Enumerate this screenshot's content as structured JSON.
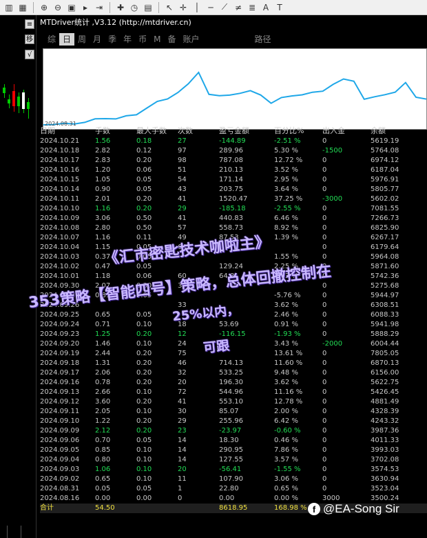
{
  "toolbar": {
    "icons": [
      "chart-bars-icon",
      "chart-candles-icon",
      "zoom-in-icon",
      "zoom-out-icon",
      "tile-windows-icon",
      "auto-scroll-icon",
      "chart-shift-icon",
      "new-order-icon",
      "periodicity-icon",
      "template-icon",
      "cursor-icon",
      "crosshair-icon",
      "vertical-line-icon",
      "horizontal-line-icon",
      "trendline-icon",
      "channel-icon",
      "fibonacci-icon",
      "text-icon",
      "label-icon"
    ]
  },
  "panel": {
    "title": "MTDriver统计 ,V3.12 (http://mtdriver.cn)",
    "menu": [
      "综",
      "日",
      "周",
      "月",
      "季",
      "年",
      "币",
      "M",
      "备",
      "账户",
      "路径"
    ],
    "active_menu": "日",
    "side_buttons": [
      "≡",
      "移",
      "√"
    ],
    "equity_start_label": "2024.08.31"
  },
  "table": {
    "headers": [
      "日期",
      "手数",
      "最大手数",
      "次数",
      "盈亏金额",
      "百分比%",
      "出入金",
      "余额"
    ],
    "rows": [
      [
        "2024.10.21",
        "1.56",
        "0.18",
        "27",
        "-144.89",
        "-2.51 %",
        "0",
        "5619.19"
      ],
      [
        "2024.10.18",
        "2.82",
        "0.12",
        "97",
        "289.96",
        "5.30 %",
        "-1500",
        "5764.08"
      ],
      [
        "2024.10.17",
        "2.83",
        "0.20",
        "98",
        "787.08",
        "12.72 %",
        "0",
        "6974.12"
      ],
      [
        "2024.10.16",
        "1.20",
        "0.06",
        "51",
        "210.13",
        "3.52 %",
        "0",
        "6187.04"
      ],
      [
        "2024.10.15",
        "1.05",
        "0.05",
        "54",
        "171.14",
        "2.95 %",
        "0",
        "5976.91"
      ],
      [
        "2024.10.14",
        "0.90",
        "0.05",
        "43",
        "203.75",
        "3.64 %",
        "0",
        "5805.77"
      ],
      [
        "2024.10.11",
        "2.01",
        "0.20",
        "41",
        "1520.47",
        "37.25 %",
        "-3000",
        "5602.02"
      ],
      [
        "2024.10.10",
        "1.16",
        "0.20",
        "29",
        "-185.18",
        "-2.55 %",
        "0",
        "7081.55"
      ],
      [
        "2024.10.09",
        "3.06",
        "0.50",
        "41",
        "440.83",
        "6.46 %",
        "0",
        "7266.73"
      ],
      [
        "2024.10.08",
        "2.80",
        "0.50",
        "57",
        "558.73",
        "8.92 %",
        "0",
        "6825.90"
      ],
      [
        "2024.10.07",
        "1.16",
        "0.11",
        "49",
        "87.53",
        "1.39 %",
        "0",
        "6267.17"
      ],
      [
        "2024.10.04",
        "1.15",
        "0.05",
        "64",
        "",
        "",
        "0",
        "6179.64"
      ],
      [
        "2024.10.03",
        "0.37",
        "0.05",
        "",
        "",
        "1.55 %",
        "0",
        "5964.08"
      ],
      [
        "2024.10.02",
        "0.47",
        "0.05",
        "",
        "129.24",
        "2.25 %",
        "0",
        "5871.60"
      ],
      [
        "2024.10.01",
        "1.18",
        "0.06",
        "60",
        "64.81",
        "1.03 %",
        "0",
        "5742.36"
      ],
      [
        "2024.09.30",
        "2.07",
        "0.30",
        "39",
        "",
        "",
        "0",
        "5275.68"
      ],
      [
        "2024.09.27",
        "0.81",
        "0.05",
        "",
        "",
        "-5.76 %",
        "0",
        "5944.97"
      ],
      [
        "2024.09.26",
        "",
        "",
        "33",
        "",
        "3.62 %",
        "0",
        "6308.51"
      ],
      [
        "2024.09.25",
        "0.65",
        "0.05",
        "",
        "",
        "2.46 %",
        "0",
        "6088.33"
      ],
      [
        "2024.09.24",
        "0.71",
        "0.10",
        "18",
        "53.69",
        "0.91 %",
        "0",
        "5941.98"
      ],
      [
        "2024.09.23",
        "1.25",
        "0.20",
        "12",
        "-116.15",
        "-1.93 %",
        "0",
        "5888.29"
      ],
      [
        "2024.09.20",
        "1.46",
        "0.10",
        "24",
        "",
        "3.43 %",
        "-2000",
        "6004.44"
      ],
      [
        "2024.09.19",
        "2.44",
        "0.20",
        "75",
        "",
        "13.61 %",
        "0",
        "7805.05"
      ],
      [
        "2024.09.18",
        "1.31",
        "0.20",
        "46",
        "714.13",
        "11.60 %",
        "0",
        "6870.13"
      ],
      [
        "2024.09.17",
        "2.06",
        "0.20",
        "32",
        "533.25",
        "9.48 %",
        "0",
        "6156.00"
      ],
      [
        "2024.09.16",
        "0.78",
        "0.20",
        "20",
        "196.30",
        "3.62 %",
        "0",
        "5622.75"
      ],
      [
        "2024.09.13",
        "2.66",
        "0.10",
        "72",
        "544.96",
        "11.16 %",
        "0",
        "5426.45"
      ],
      [
        "2024.09.12",
        "3.60",
        "0.20",
        "41",
        "553.10",
        "12.78 %",
        "0",
        "4881.49"
      ],
      [
        "2024.09.11",
        "2.05",
        "0.10",
        "30",
        "85.07",
        "2.00 %",
        "0",
        "4328.39"
      ],
      [
        "2024.09.10",
        "1.22",
        "0.20",
        "29",
        "255.96",
        "6.42 %",
        "0",
        "4243.32"
      ],
      [
        "2024.09.09",
        "2.12",
        "0.20",
        "23",
        "-23.97",
        "-0.60 %",
        "0",
        "3987.36"
      ],
      [
        "2024.09.06",
        "0.70",
        "0.05",
        "14",
        "18.30",
        "0.46 %",
        "0",
        "4011.33"
      ],
      [
        "2024.09.05",
        "0.85",
        "0.10",
        "14",
        "290.95",
        "7.86 %",
        "0",
        "3993.03"
      ],
      [
        "2024.09.04",
        "0.80",
        "0.10",
        "14",
        "127.55",
        "3.57 %",
        "0",
        "3702.08"
      ],
      [
        "2024.09.03",
        "1.06",
        "0.10",
        "20",
        "-56.41",
        "-1.55 %",
        "0",
        "3574.53"
      ],
      [
        "2024.09.02",
        "0.65",
        "0.10",
        "11",
        "107.90",
        "3.06 %",
        "0",
        "3630.94"
      ],
      [
        "2024.08.31",
        "0.05",
        "0.05",
        "1",
        "22.80",
        "0.65 %",
        "0",
        "3523.04"
      ],
      [
        "2024.08.16",
        "0.00",
        "0.00",
        "0",
        "0.00",
        "0.00 %",
        "3000",
        "3500.24"
      ]
    ],
    "total": [
      "合计",
      "54.50",
      "",
      "",
      "8618.95",
      "168.98 %",
      "",
      ""
    ]
  },
  "watermark": {
    "line1": "《汇市密匙技术咖啦主》",
    "line2": "353策略【智能四号】策略，总体回撤控制在",
    "line3": "25%以内，",
    "line4": "可跟"
  },
  "credit": {
    "text": "@EA-Song Sir",
    "icon": "facebook-icon"
  },
  "colors": {
    "positive": "#f0f0f0",
    "negative": "#22dd55",
    "total": "#f0e040",
    "equity_line": "#1ea7e8"
  }
}
